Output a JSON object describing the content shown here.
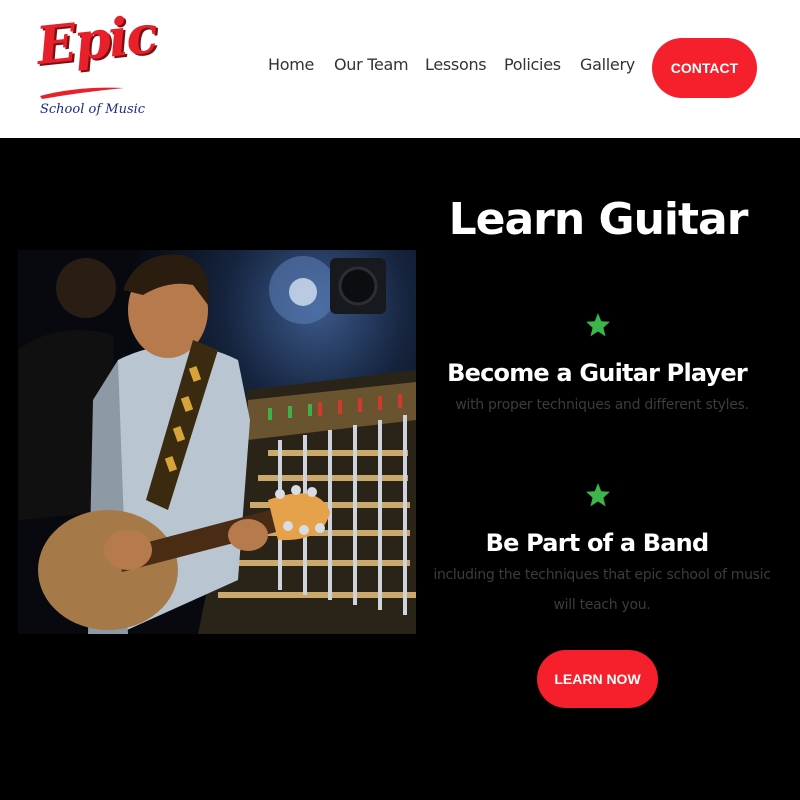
{
  "brand": {
    "logo_main": "Epic",
    "logo_sub": "School of Music"
  },
  "nav": {
    "items": [
      {
        "label": "Home"
      },
      {
        "label": "Our Team"
      },
      {
        "label": "Lessons"
      },
      {
        "label": "Policies"
      },
      {
        "label": "Gallery"
      }
    ],
    "contact_label": "CONTACT"
  },
  "hero": {
    "title": "Learn Guitar",
    "features": [
      {
        "icon": "star-icon",
        "title": "Become a Guitar Player",
        "description": "with proper techniques and different styles."
      },
      {
        "icon": "star-icon",
        "title": "Be Part of a Band",
        "description": "including the techniques that epic school of music will teach you."
      }
    ],
    "cta_label": "LEARN NOW"
  },
  "colors": {
    "accent": "#f5202b",
    "star": "#3cb54a",
    "header_bg": "#ffffff",
    "hero_bg": "#000000",
    "logo_blue": "#1a2a8c"
  }
}
